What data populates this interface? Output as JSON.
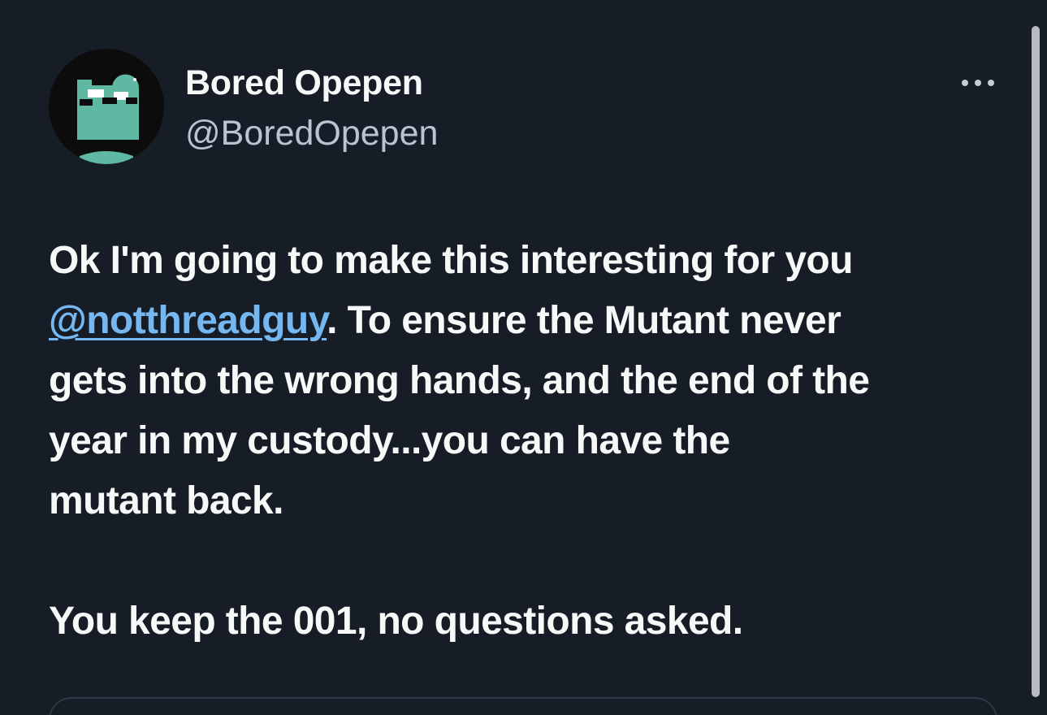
{
  "tweet": {
    "author": {
      "display_name": "Bored Opepen",
      "handle": "@BoredOpepen"
    },
    "more_menu_icon": "ellipsis-icon",
    "text": {
      "line1": "Ok I'm going to make this interesting for you",
      "mention": "@notthreadguy",
      "line2_rest": ". To ensure the Mutant never",
      "line3": "gets into the wrong hands, and the end of the",
      "line4": "year in my custody...you can have the",
      "line5": "mutant back.",
      "line6": "You keep the 001, no questions asked."
    }
  },
  "colors": {
    "background": "#161d27",
    "text": "#f7f9f9",
    "handle": "#b9c4d0",
    "link": "#74b7f1",
    "avatar_accent": "#5fb9a2"
  }
}
